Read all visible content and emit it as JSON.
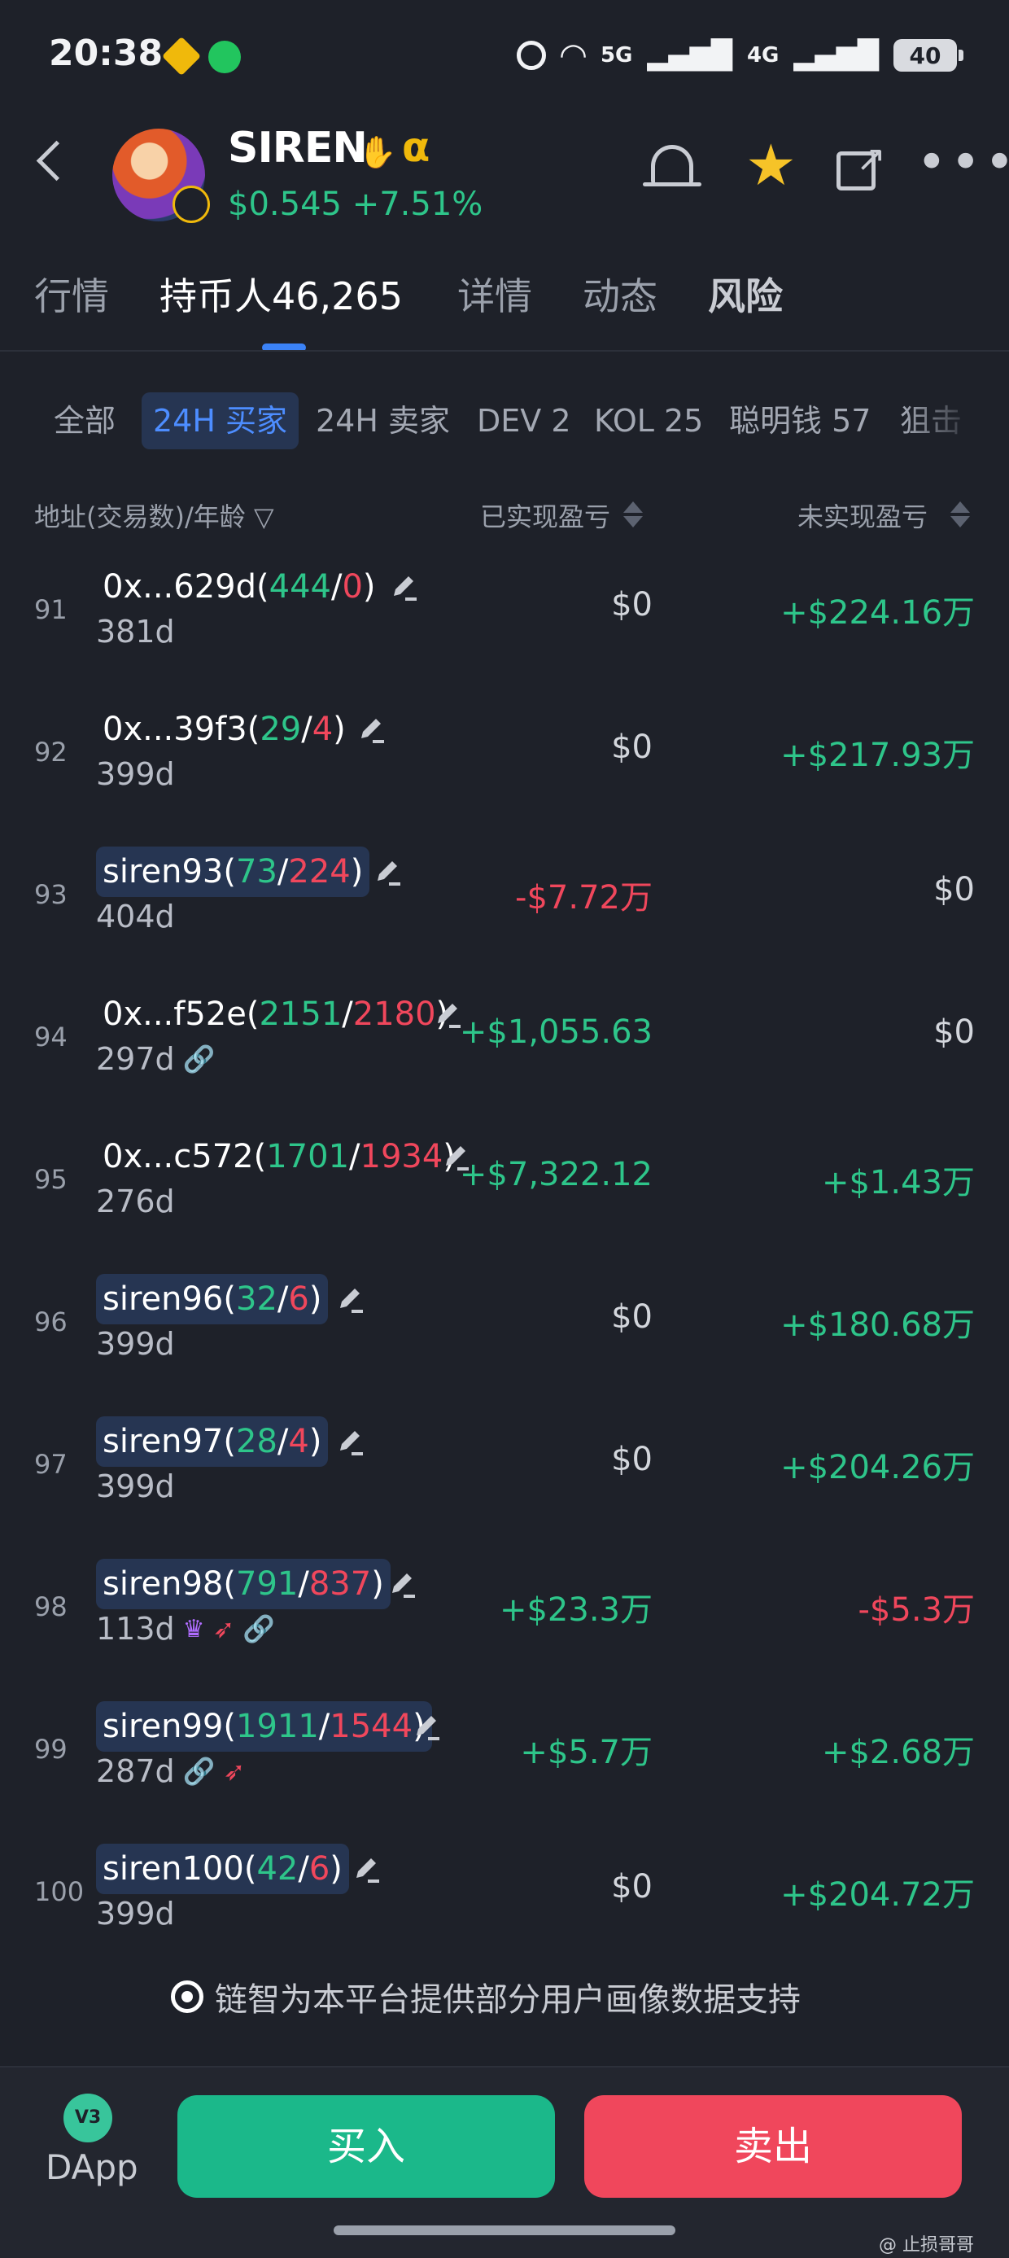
{
  "status": {
    "time": "20:38",
    "net1": "5G",
    "net2": "4G",
    "battery": "40"
  },
  "header": {
    "token": "SIREN",
    "alpha": "α",
    "price": "$0.545",
    "change": "+7.51%"
  },
  "tabs": [
    "行情",
    "持币人46,265",
    "详情",
    "动态",
    "风险"
  ],
  "filters": [
    "全部",
    "24H 买家",
    "24H 卖家",
    "DEV 2",
    "KOL 25",
    "聪明钱 57",
    "狙击"
  ],
  "columns": {
    "address": "地址(交易数)/年龄",
    "realized": "已实现盈亏",
    "unrealized": "未实现盈亏"
  },
  "rows": [
    {
      "rank": "91",
      "addr": "0x...629d",
      "buys": "444",
      "sells": "0",
      "age": "381d",
      "realized": "$0",
      "unrealized": "+$224.16万"
    },
    {
      "rank": "92",
      "addr": "0x...39f3",
      "buys": "29",
      "sells": "4",
      "age": "399d",
      "realized": "$0",
      "unrealized": "+$217.93万"
    },
    {
      "rank": "93",
      "addr": "siren93",
      "buys": "73",
      "sells": "224",
      "age": "404d",
      "realized": "-$7.72万",
      "unrealized": "$0"
    },
    {
      "rank": "94",
      "addr": "0x...f52e",
      "buys": "2151",
      "sells": "2180",
      "age": "297d",
      "realized": "+$1,055.63",
      "unrealized": "$0"
    },
    {
      "rank": "95",
      "addr": "0x...c572",
      "buys": "1701",
      "sells": "1934",
      "age": "276d",
      "realized": "+$7,322.12",
      "unrealized": "+$1.43万"
    },
    {
      "rank": "96",
      "addr": "siren96",
      "buys": "32",
      "sells": "6",
      "age": "399d",
      "realized": "$0",
      "unrealized": "+$180.68万"
    },
    {
      "rank": "97",
      "addr": "siren97",
      "buys": "28",
      "sells": "4",
      "age": "399d",
      "realized": "$0",
      "unrealized": "+$204.26万"
    },
    {
      "rank": "98",
      "addr": "siren98",
      "buys": "791",
      "sells": "837",
      "age": "113d",
      "realized": "+$23.3万",
      "unrealized": "-$5.3万"
    },
    {
      "rank": "99",
      "addr": "siren99",
      "buys": "1911",
      "sells": "1544",
      "age": "287d",
      "realized": "+$5.7万",
      "unrealized": "+$2.68万"
    },
    {
      "rank": "100",
      "addr": "siren100",
      "buys": "42",
      "sells": "6",
      "age": "399d",
      "realized": "$0",
      "unrealized": "+$204.72万"
    }
  ],
  "note": "链智为本平台提供部分用户画像数据支持",
  "bottom": {
    "dapp_badge": "V3",
    "dapp": "DApp",
    "buy": "买入",
    "sell": "卖出",
    "watermark": "@ 止损哥哥"
  },
  "colors": {
    "positive": "#2ec58a",
    "negative": "#f0475c",
    "accent": "#4d8dff",
    "buy": "#1bb88a",
    "sell": "#f0475c"
  }
}
